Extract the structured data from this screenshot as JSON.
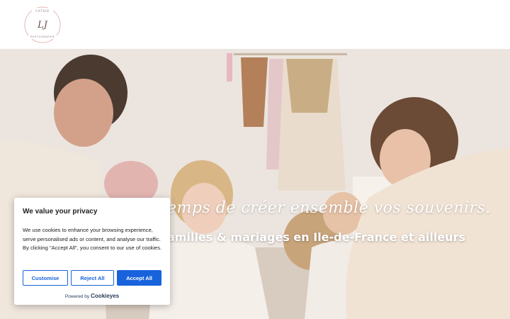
{
  "header": {
    "logo": {
      "top_text": "CATHIE",
      "monogram": "LJ",
      "bottom_text": "PHOTOGRAPHIE"
    }
  },
  "hero": {
    "tagline": "emps de créer ensemble vos souvenirs.",
    "subtitle": "amilles & mariages en Ile-de-France et ailleurs"
  },
  "cookie_banner": {
    "title": "We value your privacy",
    "text": "We use cookies to enhance your browsing experience, serve personalised ads or content, and analyse our traffic. By clicking \"Accept All\", you consent to our use of cookies.",
    "buttons": {
      "customise": "Customise",
      "reject": "Reject All",
      "accept": "Accept All"
    },
    "powered_by": "Powered by",
    "brand": "Cookieyes"
  },
  "colors": {
    "accent": "#1863dc",
    "logo_ring": "#e7b4b4"
  }
}
